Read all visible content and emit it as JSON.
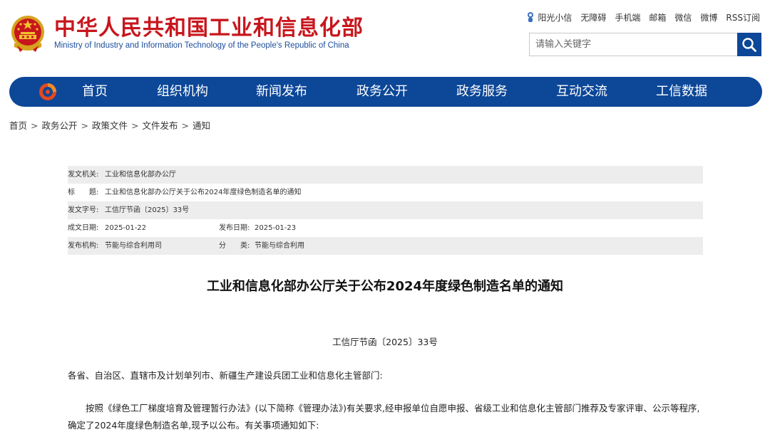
{
  "header": {
    "site_title_cn": "中华人民共和国工业和信息化部",
    "site_title_en": "Ministry of Industry and Information Technology of the People's Republic of China",
    "top_links": [
      "阳光小信",
      "无障碍",
      "手机端",
      "邮箱",
      "微信",
      "微博",
      "RSS订阅"
    ],
    "search_placeholder": "请输入关键字"
  },
  "nav": {
    "items": [
      "首页",
      "组织机构",
      "新闻发布",
      "政务公开",
      "政务服务",
      "互动交流",
      "工信数据"
    ]
  },
  "breadcrumb": [
    "首页",
    "政务公开",
    "政策文件",
    "文件发布",
    "通知"
  ],
  "breadcrumb_sep": ">",
  "meta": {
    "issuer_label": "发文机关:",
    "issuer": "工业和信息化部办公厅",
    "title_label": "标　　题:",
    "title": "工业和信息化部办公厅关于公布2024年度绿色制造名单的通知",
    "doc_no_label": "发文字号:",
    "doc_no": "工信厅节函〔2025〕33号",
    "created_label": "成文日期:",
    "created": "2025-01-22",
    "published_label": "发布日期:",
    "published": "2025-01-23",
    "org_label": "发布机构:",
    "org": "节能与综合利用司",
    "category_label": "分　　类:",
    "category": "节能与综合利用"
  },
  "article": {
    "title": "工业和信息化部办公厅关于公布2024年度绿色制造名单的通知",
    "doc_number": "工信厅节函〔2025〕33号",
    "recipient": "各省、自治区、直辖市及计划单列市、新疆生产建设兵团工业和信息化主管部门:",
    "paragraph1": "按照《绿色工厂梯度培育及管理暂行办法》(以下简称《管理办法》)有关要求,经申报单位自愿申报、省级工业和信息化主管部门推荐及专家评审、公示等程序,确定了2024年度绿色制造名单,现予以公布。有关事项通知如下:"
  },
  "colors": {
    "brand_red": "#c8161d",
    "brand_blue": "#0c4798",
    "meta_shade": "#ededed"
  }
}
